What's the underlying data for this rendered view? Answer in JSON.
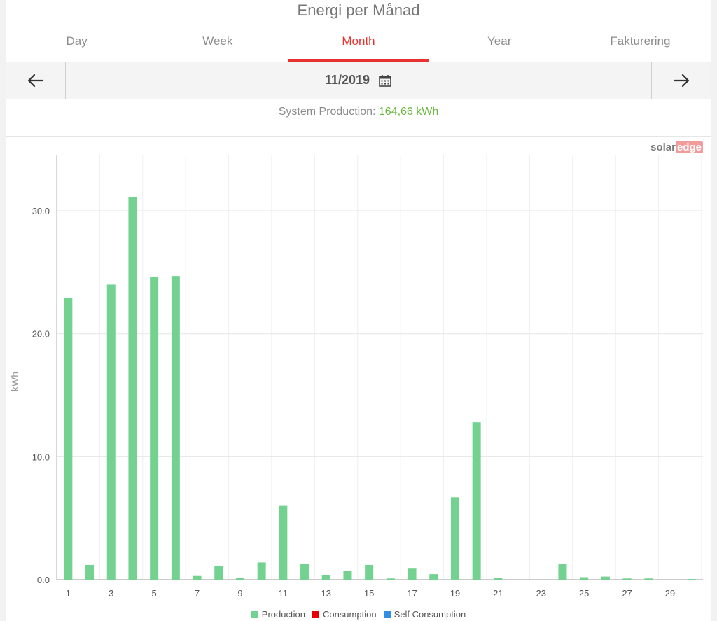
{
  "header": {
    "title": "Energi per Månad"
  },
  "tabs": [
    {
      "label": "Day",
      "active": false
    },
    {
      "label": "Week",
      "active": false
    },
    {
      "label": "Month",
      "active": true
    },
    {
      "label": "Year",
      "active": false
    },
    {
      "label": "Fakturering",
      "active": false
    }
  ],
  "date_bar": {
    "date": "11/2019",
    "prev_icon": "arrow-left-icon",
    "next_icon": "arrow-right-icon",
    "calendar_icon": "calendar-icon"
  },
  "summary": {
    "label": "System Production:",
    "value": "164,66 kWh"
  },
  "brand": {
    "solar": "solar",
    "edge": "edge"
  },
  "colors": {
    "accent": "#e8322f",
    "production": "#74d291",
    "consumption": "#e60000",
    "self_consumption": "#2f8fe0",
    "summary_value": "#69b83c"
  },
  "chart_data": {
    "type": "bar",
    "ylabel": "kWh",
    "ylim": [
      0,
      34.5
    ],
    "yticks": [
      0,
      10,
      20,
      30
    ],
    "ytick_labels": [
      "0.0",
      "10.0",
      "20.0",
      "30.0"
    ],
    "categories": [
      1,
      2,
      3,
      4,
      5,
      6,
      7,
      8,
      9,
      10,
      11,
      12,
      13,
      14,
      15,
      16,
      17,
      18,
      19,
      20,
      21,
      22,
      23,
      24,
      25,
      26,
      27,
      28,
      29,
      30
    ],
    "xtick_labels": [
      "1",
      "3",
      "5",
      "7",
      "9",
      "11",
      "13",
      "15",
      "17",
      "19",
      "21",
      "23",
      "25",
      "27",
      "29"
    ],
    "grid": true,
    "legend_position": "bottom",
    "series": [
      {
        "name": "Production",
        "color": "#74d291",
        "values": [
          22.9,
          1.2,
          24.0,
          31.1,
          24.6,
          24.7,
          0.3,
          1.1,
          0.15,
          1.4,
          6.0,
          1.3,
          0.35,
          0.7,
          1.2,
          0.1,
          0.9,
          0.45,
          6.7,
          12.8,
          0.15,
          0.0,
          0.0,
          1.3,
          0.2,
          0.25,
          0.1,
          0.1,
          0.0,
          0.05
        ]
      },
      {
        "name": "Consumption",
        "color": "#e60000",
        "values": []
      },
      {
        "name": "Self Consumption",
        "color": "#2f8fe0",
        "values": []
      }
    ]
  }
}
